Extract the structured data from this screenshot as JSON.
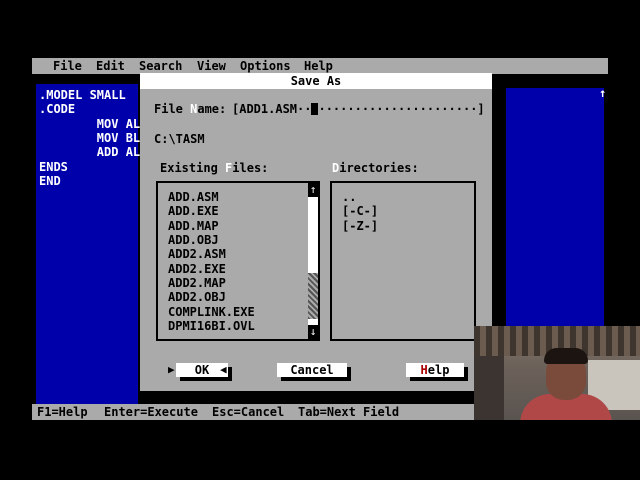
{
  "menu": [
    "File",
    "Edit",
    "Search",
    "View",
    "Options",
    "Help"
  ],
  "editor_lines": [
    ".MODEL SMALL",
    ".CODE",
    "        MOV AL",
    "        MOV BL",
    "        ADD AL",
    "ENDS",
    "END"
  ],
  "status_items": [
    "F1=Help",
    "Enter=Execute",
    "Esc=Cancel",
    "Tab=Next Field"
  ],
  "dialog": {
    "title": "Save As",
    "filename_label_pre": "File ",
    "filename_label_hot": "N",
    "filename_label_post": "ame:",
    "filename_field": "[ADD1.ASM··",
    "filename_tail": "······················]",
    "current_dir": "C:\\TASM",
    "files_label_pre": "Existing ",
    "files_label_hot": "F",
    "files_label_post": "iles:",
    "dirs_label_hot": "D",
    "dirs_label_post": "irectories:",
    "files": [
      "ADD.ASM",
      "ADD.EXE",
      "ADD.MAP",
      "ADD.OBJ",
      "ADD2.ASM",
      "ADD2.EXE",
      "ADD2.MAP",
      "ADD2.OBJ",
      "COMPLINK.EXE",
      "DPMI16BI.OVL"
    ],
    "directories": [
      "..",
      "[-C-]",
      "[-Z-]"
    ],
    "ok_label": "OK",
    "cancel_label": "Cancel",
    "help_hot": "H",
    "help_post": "elp"
  }
}
